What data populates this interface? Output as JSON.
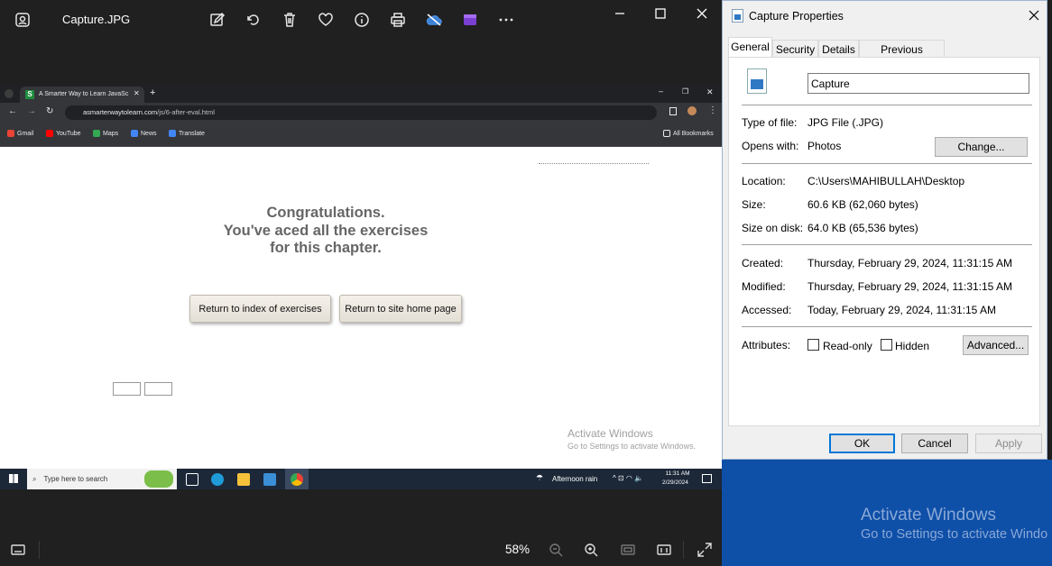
{
  "photos": {
    "title": "Capture.JPG",
    "toolbar_icons": [
      "photos-app-icon",
      "edit-icon",
      "rotate-icon",
      "delete-icon",
      "favorite-icon",
      "info-icon",
      "print-icon",
      "onedrive-icon",
      "clipchamp-icon",
      "more-icon"
    ],
    "window_controls": [
      "minimize-icon",
      "maximize-icon",
      "close-icon"
    ],
    "zoom": "58%"
  },
  "screenshot": {
    "tab_title": "A Smarter Way to Learn JavaSc",
    "url_domain": "asmarterwaytolearn.com",
    "url_path": "/js/6-after-eval.html",
    "bookmarks": [
      "Gmail",
      "YouTube",
      "Maps",
      "News",
      "Translate"
    ],
    "all_bookmarks": "All Bookmarks",
    "congrats": [
      "Congratulations.",
      "You've aced all the exercises",
      "for this chapter."
    ],
    "buttons": [
      "Return to index of exercises",
      "Return to site home page"
    ],
    "activate": {
      "title": "Activate Windows",
      "sub": "Go to Settings to activate Windows."
    },
    "taskbar": {
      "search": "Type here to search",
      "weather": "Afternoon rain",
      "time": "11:31 AM",
      "date": "2/29/2024"
    }
  },
  "desktop": {
    "activate_title": "Activate Windows",
    "activate_sub": "Go to Settings to activate Windo"
  },
  "props": {
    "title": "Capture Properties",
    "tabs": [
      "General",
      "Security",
      "Details",
      "Previous Versions"
    ],
    "name": "Capture",
    "type_label": "Type of file:",
    "type_value": "JPG File (.JPG)",
    "opens_label": "Opens with:",
    "opens_value": "Photos",
    "change": "Change...",
    "location_label": "Location:",
    "location_value": "C:\\Users\\MAHIBULLAH\\Desktop",
    "size_label": "Size:",
    "size_value": "60.6 KB (62,060 bytes)",
    "sod_label": "Size on disk:",
    "sod_value": "64.0 KB (65,536 bytes)",
    "created_label": "Created:",
    "created_value": "Thursday, February 29, 2024, 11:31:15 AM",
    "modified_label": "Modified:",
    "modified_value": "Thursday, February 29, 2024, 11:31:15 AM",
    "accessed_label": "Accessed:",
    "accessed_value": "Today, February 29, 2024, 11:31:15 AM",
    "attributes_label": "Attributes:",
    "readonly": "Read-only",
    "hidden": "Hidden",
    "advanced": "Advanced...",
    "ok": "OK",
    "cancel": "Cancel",
    "apply": "Apply"
  }
}
